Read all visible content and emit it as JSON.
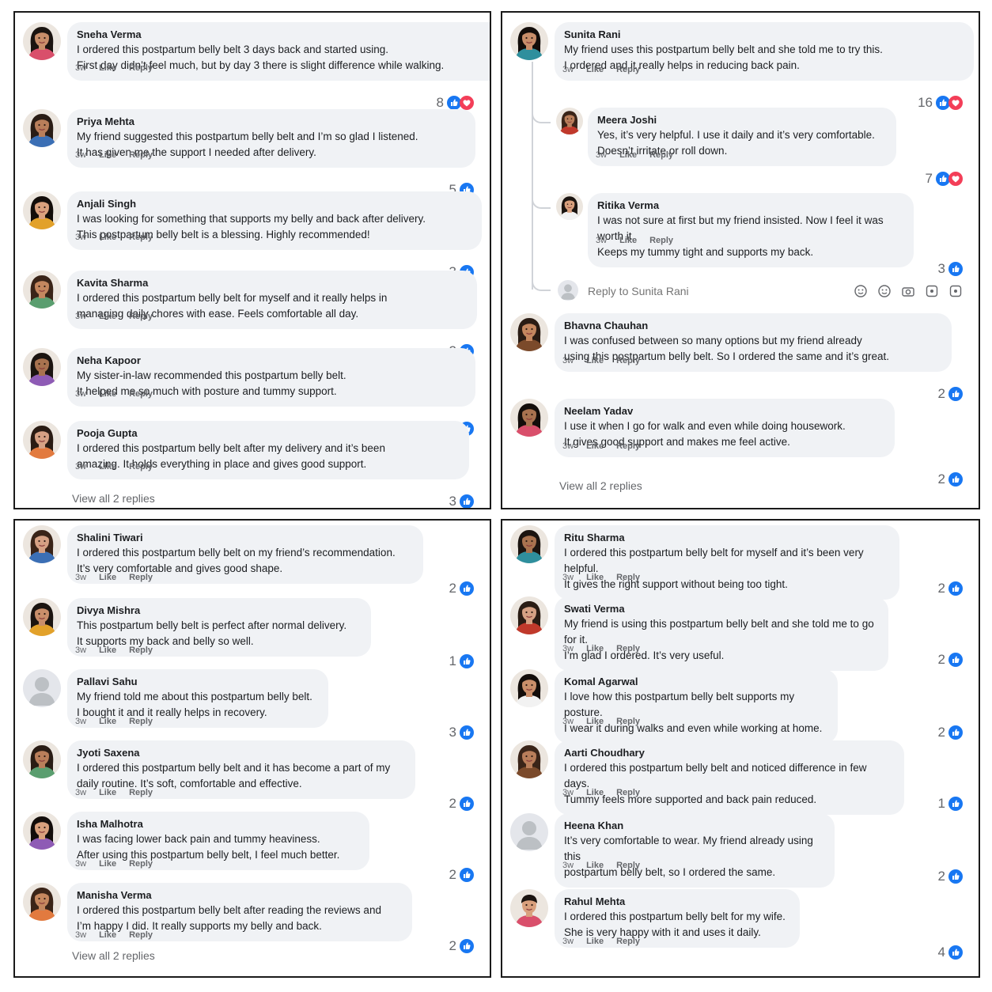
{
  "labels": {
    "time": "3w",
    "like": "Like",
    "reply": "Reply"
  },
  "colors": {
    "like_blue": "#1877f2",
    "love_red": "#f33e58",
    "bubble": "#f0f2f5",
    "meta": "#65676b"
  },
  "panels": [
    {
      "comments": [
        {
          "name": "Sneha Verma",
          "lines": [
            "I ordered this postpartum belly belt 3 days back and started using.",
            "First day didn’t feel much, but by day 3 there is slight difference while walking."
          ],
          "count": "8",
          "reactions": [
            "like-icon",
            "love-icon"
          ]
        },
        {
          "name": "Priya Mehta",
          "lines": [
            "My friend suggested this postpartum belly belt and I’m so glad I listened.",
            "It has given me the support I needed after delivery."
          ],
          "count": "5",
          "reactions": [
            "like-icon"
          ]
        },
        {
          "name": "Anjali Singh",
          "lines": [
            "I was looking for something that supports my belly and back after delivery.",
            "This postpartum belly belt is a blessing. Highly recommended!"
          ],
          "count": "3",
          "reactions": [
            "like-icon"
          ]
        },
        {
          "name": "Kavita Sharma",
          "lines": [
            "I ordered this postpartum belly belt for myself and it really helps in",
            "managing daily chores with ease. Feels comfortable all day."
          ],
          "count": "2",
          "reactions": [
            "like-icon"
          ]
        },
        {
          "name": "Neha Kapoor",
          "lines": [
            "My sister-in-law recommended this postpartum belly belt.",
            "It helped me so much with posture and tummy support."
          ],
          "count": "2",
          "reactions": [
            "like-icon"
          ]
        },
        {
          "name": "Pooja Gupta",
          "lines": [
            "I ordered this postpartum belly belt after my delivery and it’s been",
            "amazing. It holds everything in place and gives good support."
          ],
          "count": "3",
          "reactions": [
            "like-icon"
          ]
        }
      ],
      "view_all": "View all 2 replies"
    },
    {
      "comments": [
        {
          "name": "Sunita Rani",
          "lines": [
            "My friend uses this postpartum belly belt and she told me to try this.",
            "I ordered and it really helps in reducing back pain."
          ],
          "count": "16",
          "reactions": [
            "like-icon",
            "love-icon"
          ],
          "replies": [
            {
              "name": "Meera Joshi",
              "lines": [
                "Yes, it’s very helpful. I use it daily and it’s very comfortable.",
                "Doesn’t irritate or roll down."
              ],
              "count": "7",
              "reactions": [
                "like-icon",
                "love-icon"
              ]
            },
            {
              "name": "Ritika Verma",
              "lines": [
                "I was not sure at first but my friend insisted. Now I feel it was worth it.",
                "Keeps my tummy tight and supports my back."
              ],
              "count": "3",
              "reactions": [
                "like-icon"
              ]
            }
          ],
          "reply_placeholder": "Reply to Sunita Rani"
        },
        {
          "name": "Bhavna Chauhan",
          "lines": [
            "I was confused between so many options but my friend already",
            "using this postpartum belly belt. So I ordered the same and it’s great."
          ],
          "count": "2",
          "reactions": [
            "like-icon"
          ]
        },
        {
          "name": "Neelam Yadav",
          "lines": [
            "I use it when I go for walk and even while doing housework.",
            "It gives good support and makes me feel active."
          ],
          "count": "2",
          "reactions": [
            "like-icon"
          ]
        }
      ],
      "view_all": "View all 2 replies"
    },
    {
      "comments": [
        {
          "name": "Shalini Tiwari",
          "lines": [
            "I ordered this postpartum belly belt on my friend’s recommendation.",
            "It’s very comfortable and gives good shape."
          ],
          "count": "2",
          "reactions": [
            "like-icon"
          ]
        },
        {
          "name": "Divya Mishra",
          "lines": [
            "This postpartum belly belt is perfect after normal delivery.",
            "It supports my back and belly so well."
          ],
          "count": "1",
          "reactions": [
            "like-icon"
          ]
        },
        {
          "name": "Pallavi Sahu",
          "lines": [
            "My friend told me about this postpartum belly belt.",
            "I bought it and it really helps in recovery."
          ],
          "count": "3",
          "reactions": [
            "like-icon"
          ]
        },
        {
          "name": "Jyoti Saxena",
          "lines": [
            "I ordered this postpartum belly belt and it has become a part of my",
            "daily routine. It’s soft, comfortable and effective."
          ],
          "count": "2",
          "reactions": [
            "like-icon"
          ]
        },
        {
          "name": "Isha Malhotra",
          "lines": [
            "I was facing lower back pain and tummy heaviness.",
            "After using this postpartum belly belt, I feel much better."
          ],
          "count": "2",
          "reactions": [
            "like-icon"
          ]
        },
        {
          "name": "Manisha Verma",
          "lines": [
            "I ordered this postpartum belly belt after reading the reviews and",
            "I’m happy I did. It really supports my belly and back."
          ],
          "count": "2",
          "reactions": [
            "like-icon"
          ]
        }
      ],
      "view_all": "View all 2 replies"
    },
    {
      "comments": [
        {
          "name": "Ritu Sharma",
          "lines": [
            "I ordered this postpartum belly belt for myself and it’s been very helpful.",
            "It gives the right support without being too tight."
          ],
          "count": "2",
          "reactions": [
            "like-icon"
          ]
        },
        {
          "name": "Swati Verma",
          "lines": [
            "My friend is using this postpartum belly belt and she told me to go for it.",
            "I’m glad I ordered. It’s very useful."
          ],
          "count": "2",
          "reactions": [
            "like-icon"
          ]
        },
        {
          "name": "Komal Agarwal",
          "lines": [
            "I love how this postpartum belly belt supports my posture.",
            "I wear it during walks and even while working at home."
          ],
          "count": "2",
          "reactions": [
            "like-icon"
          ]
        },
        {
          "name": "Aarti Choudhary",
          "lines": [
            "I ordered this postpartum belly belt and noticed difference in few days.",
            "Tummy feels more supported and back pain reduced."
          ],
          "count": "1",
          "reactions": [
            "like-icon"
          ]
        },
        {
          "name": "Heena Khan",
          "lines": [
            "It’s very comfortable to wear. My friend already using this",
            "postpartum belly belt, so I ordered the same."
          ],
          "count": "2",
          "reactions": [
            "like-icon"
          ]
        },
        {
          "name": "Rahul Mehta",
          "lines": [
            "I ordered this postpartum belly belt for my wife.",
            "She is very happy with it and uses it daily."
          ],
          "count": "4",
          "reactions": [
            "like-icon"
          ]
        }
      ]
    }
  ]
}
